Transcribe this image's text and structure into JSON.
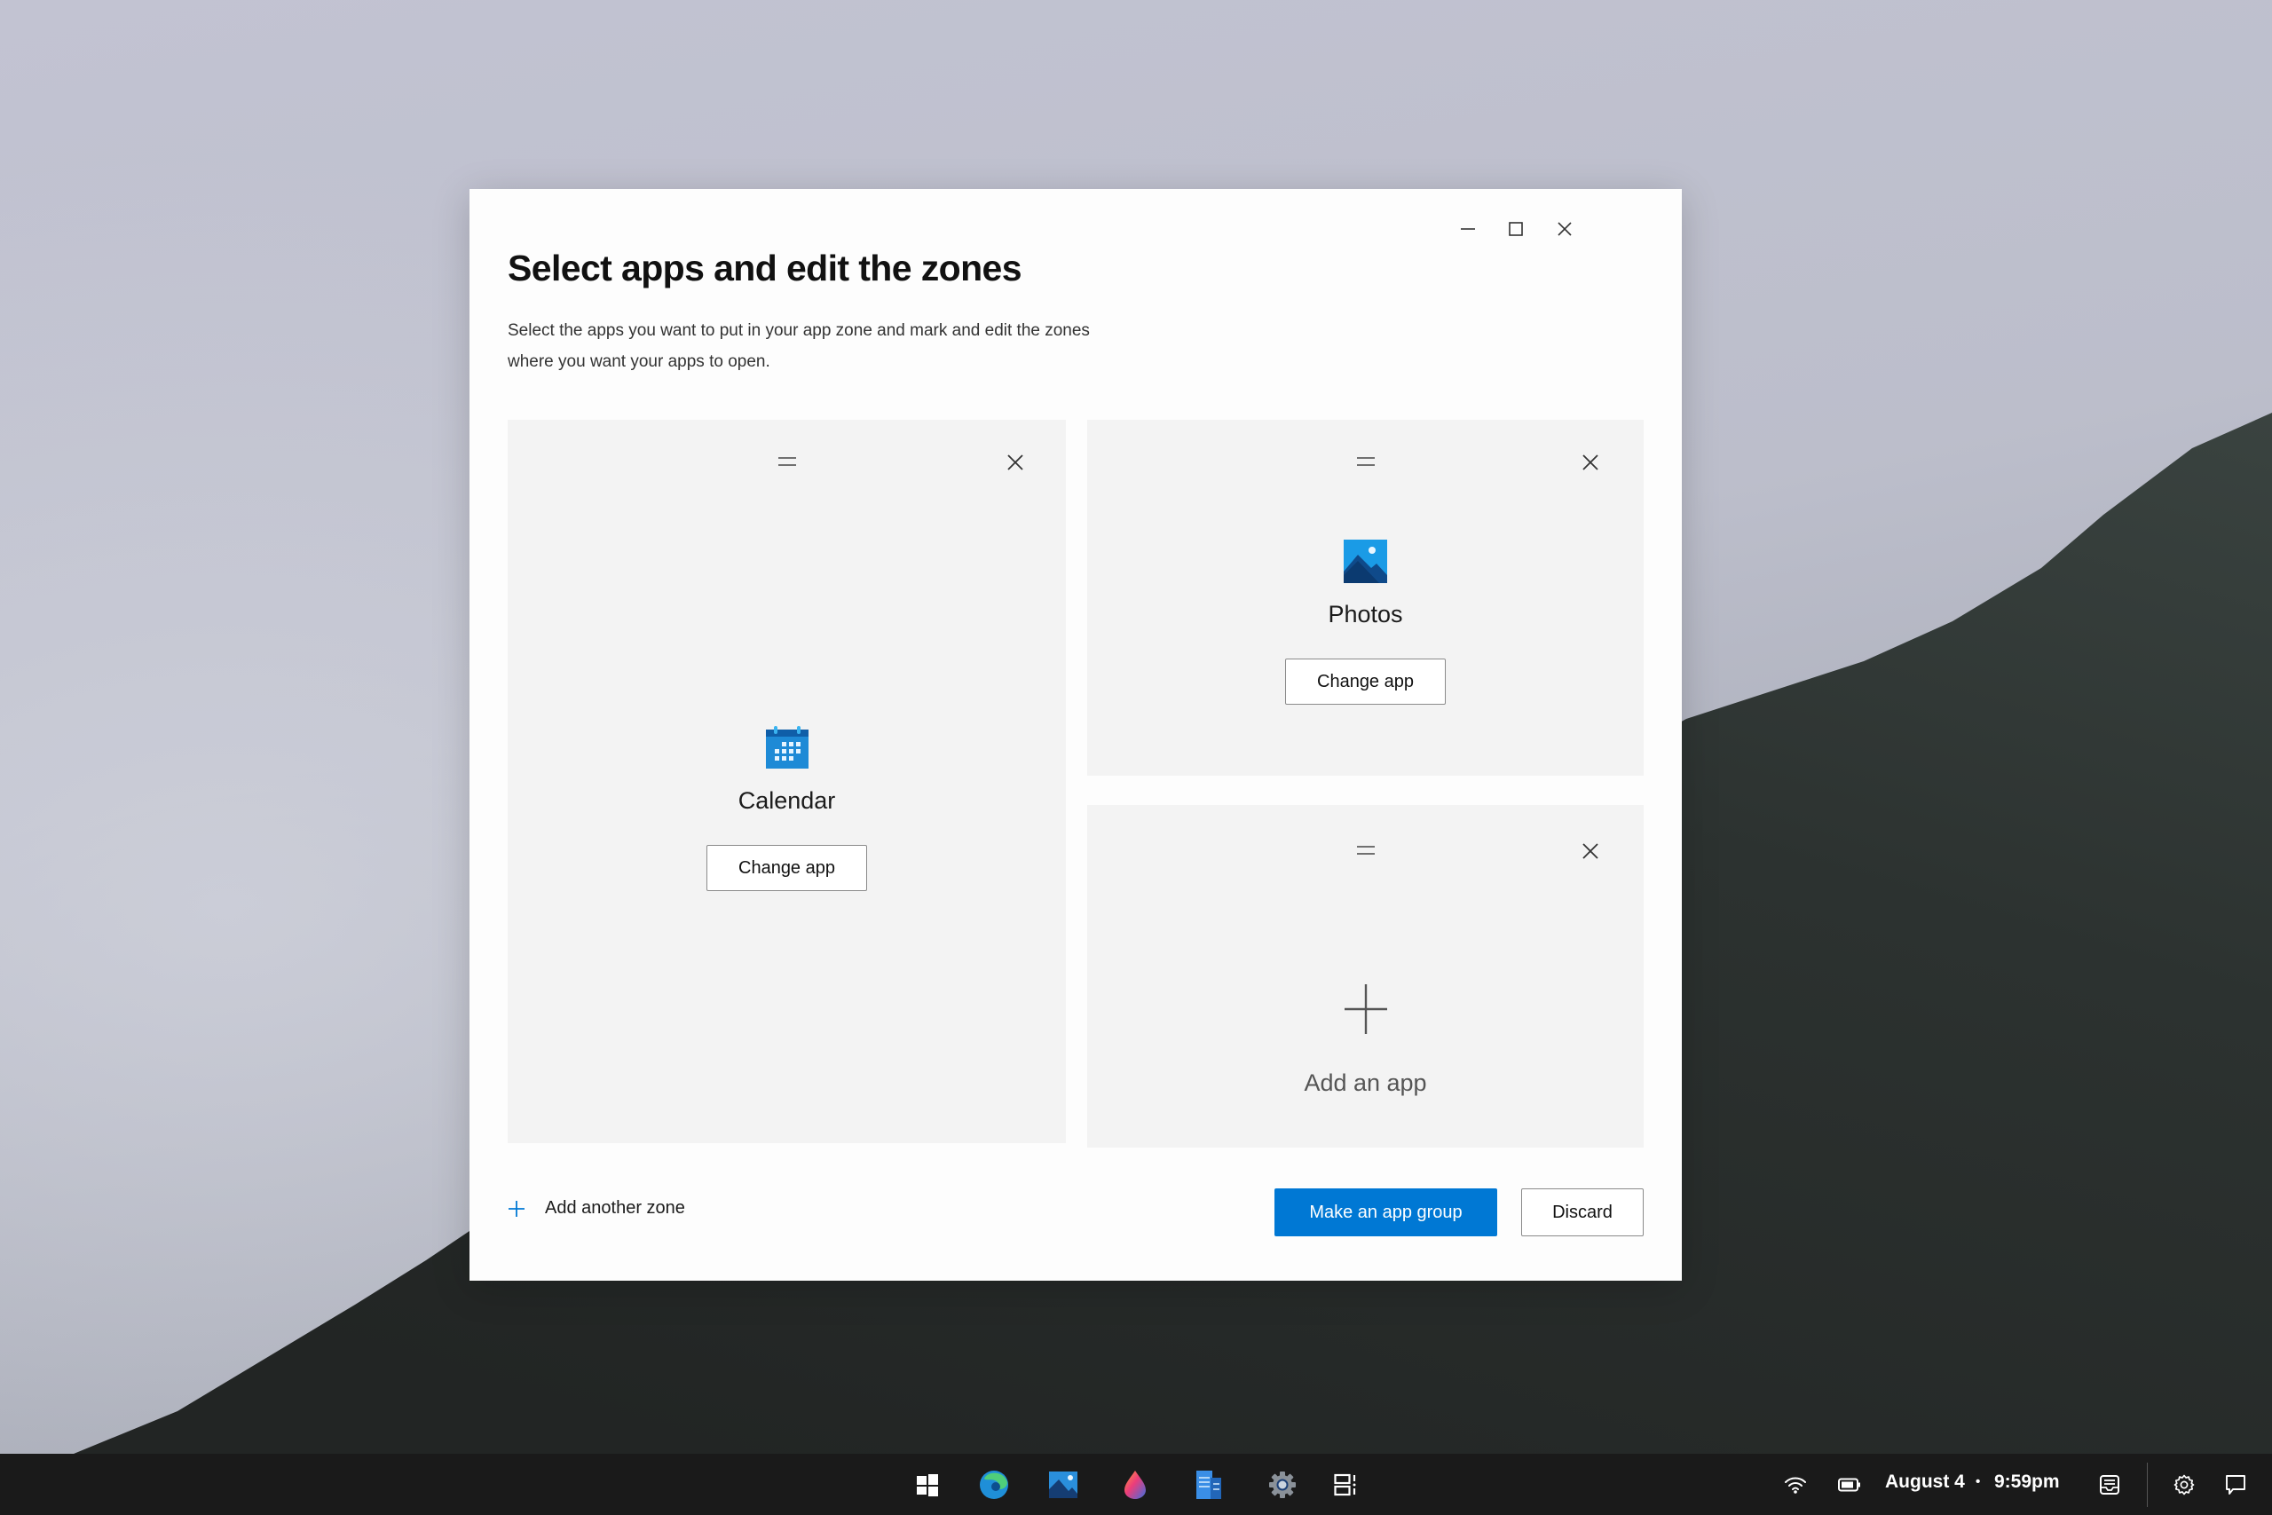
{
  "dialog": {
    "title": "Select apps and edit the zones",
    "description": "Select the apps you want to put in your app zone and mark and edit the zones where you want your apps to open.",
    "window_controls": {
      "minimize": "minimize-icon",
      "maximize": "maximize-icon",
      "close": "close-icon"
    },
    "zones": [
      {
        "app_name": "Calendar",
        "icon": "calendar-icon",
        "button_label": "Change app"
      },
      {
        "app_name": "Photos",
        "icon": "photos-icon",
        "button_label": "Change app"
      },
      {
        "placeholder_label": "Add an app",
        "icon": "plus-icon"
      }
    ],
    "add_zone_label": "Add another zone",
    "primary_button_label": "Make an app group",
    "discard_button_label": "Discard"
  },
  "taskbar": {
    "pinned_apps": [
      {
        "name": "Start",
        "icon": "windows-logo-icon"
      },
      {
        "name": "Microsoft Edge",
        "icon": "edge-icon"
      },
      {
        "name": "Photos",
        "icon": "photos-icon"
      },
      {
        "name": "Paint",
        "icon": "paint-icon"
      },
      {
        "name": "Documents",
        "icon": "document-icon"
      },
      {
        "name": "Settings",
        "icon": "settings-gear-icon"
      },
      {
        "name": "Task View",
        "icon": "task-view-icon"
      }
    ],
    "tray": {
      "date": "August 4",
      "separator": "•",
      "time": "9:59pm"
    }
  },
  "colors": {
    "accent": "#0078D4",
    "zone_background": "#F3F3F3",
    "dialog_background": "#FDFDFD",
    "taskbar_background": "#1A1A1A"
  }
}
